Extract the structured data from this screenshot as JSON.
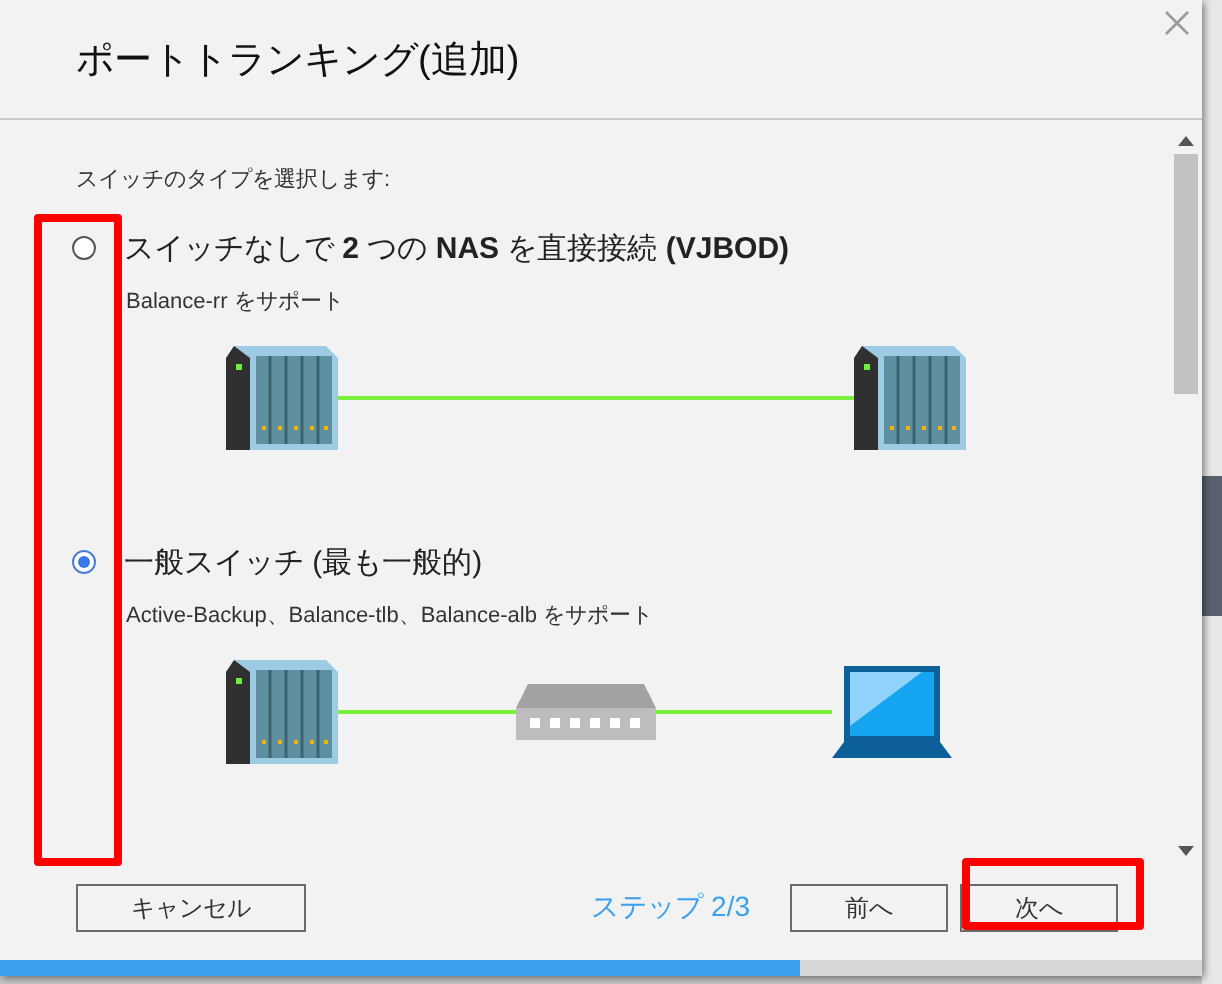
{
  "dialog": {
    "title": "ポートトランキング(追加)",
    "prompt": "スイッチのタイプを選択します:",
    "options": [
      {
        "label": "スイッチなしで **2** つの **NAS** を直接接続 **(VJBOD)**",
        "description": "Balance-rr をサポート",
        "selected": false,
        "devices": [
          {
            "kind": "nas"
          },
          {
            "kind": "nas"
          }
        ]
      },
      {
        "label": "一般スイッチ (最も一般的)",
        "description": "Active-Backup、Balance-tlb、Balance-alb をサポート",
        "selected": true,
        "devices": [
          {
            "kind": "nas"
          },
          {
            "kind": "switch"
          },
          {
            "kind": "laptop"
          }
        ]
      }
    ],
    "footer": {
      "cancel": "キャンセル",
      "step": "ステップ 2/3",
      "back": "前へ",
      "next": "次へ"
    },
    "progress": {
      "level": 0.665
    }
  }
}
